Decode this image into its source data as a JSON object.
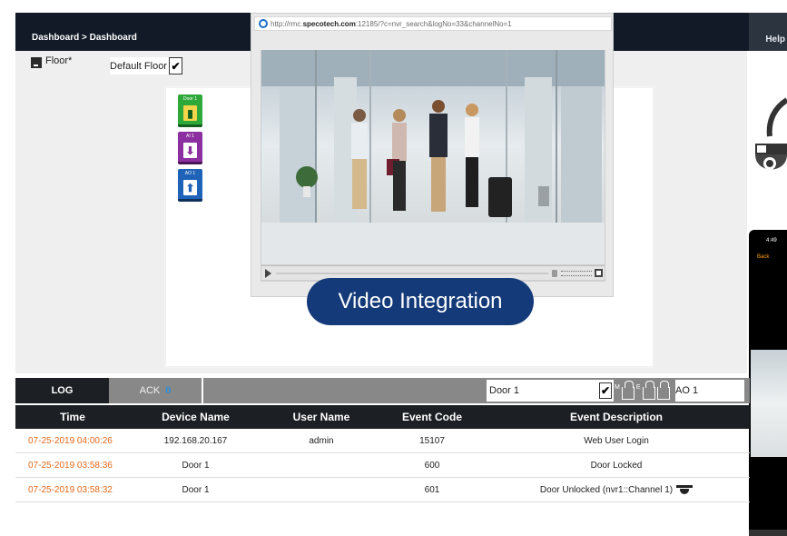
{
  "header": {
    "breadcrumb": "Dashboard > Dashboard",
    "help_label": "Help"
  },
  "floor": {
    "label": "Floor*",
    "selected": "Default Floor"
  },
  "map_devices": [
    {
      "tag": "Door 1",
      "icon": "door-icon",
      "color": "#2fa83a"
    },
    {
      "tag": "AI 1",
      "icon": "download-icon",
      "color": "#8c2fa0"
    },
    {
      "tag": "AO 1",
      "icon": "upload-icon",
      "color": "#1f63b8"
    }
  ],
  "popup": {
    "url_prefix": "http://rmc.",
    "url_host": "specotech.com",
    "url_suffix": ":12185/?c=nvr_search&logNo=33&channelNo=1"
  },
  "banner": "Video Integration",
  "phone": {
    "time": "4:49",
    "back": "Back"
  },
  "logbar": {
    "log_tab": "LOG",
    "ack_tab": "ACK",
    "ack_count": "0",
    "door_filter": "Door 1",
    "lock_letters": [
      "M",
      "E"
    ],
    "ao_filter": "AO 1"
  },
  "table": {
    "headers": {
      "time": "Time",
      "device": "Device Name",
      "user": "User Name",
      "code": "Event Code",
      "desc": "Event Description"
    },
    "rows": [
      {
        "time": "07-25-2019 04:00:26",
        "device": "192.168.20.167",
        "user": "admin",
        "code": "15107",
        "desc": "Web User Login"
      },
      {
        "time": "07-25-2019 03:58:36",
        "device": "Door 1",
        "user": "",
        "code": "600",
        "desc": "Door Locked"
      },
      {
        "time": "07-25-2019 03:58:32",
        "device": "Door 1",
        "user": "",
        "code": "601",
        "desc": "Door Unlocked (nvr1::Channel 1)"
      }
    ]
  },
  "colors": {
    "topbar": "#111a26",
    "banner": "#153a7a",
    "time_text": "#e0691c",
    "ack_count": "#2d8fd8"
  }
}
